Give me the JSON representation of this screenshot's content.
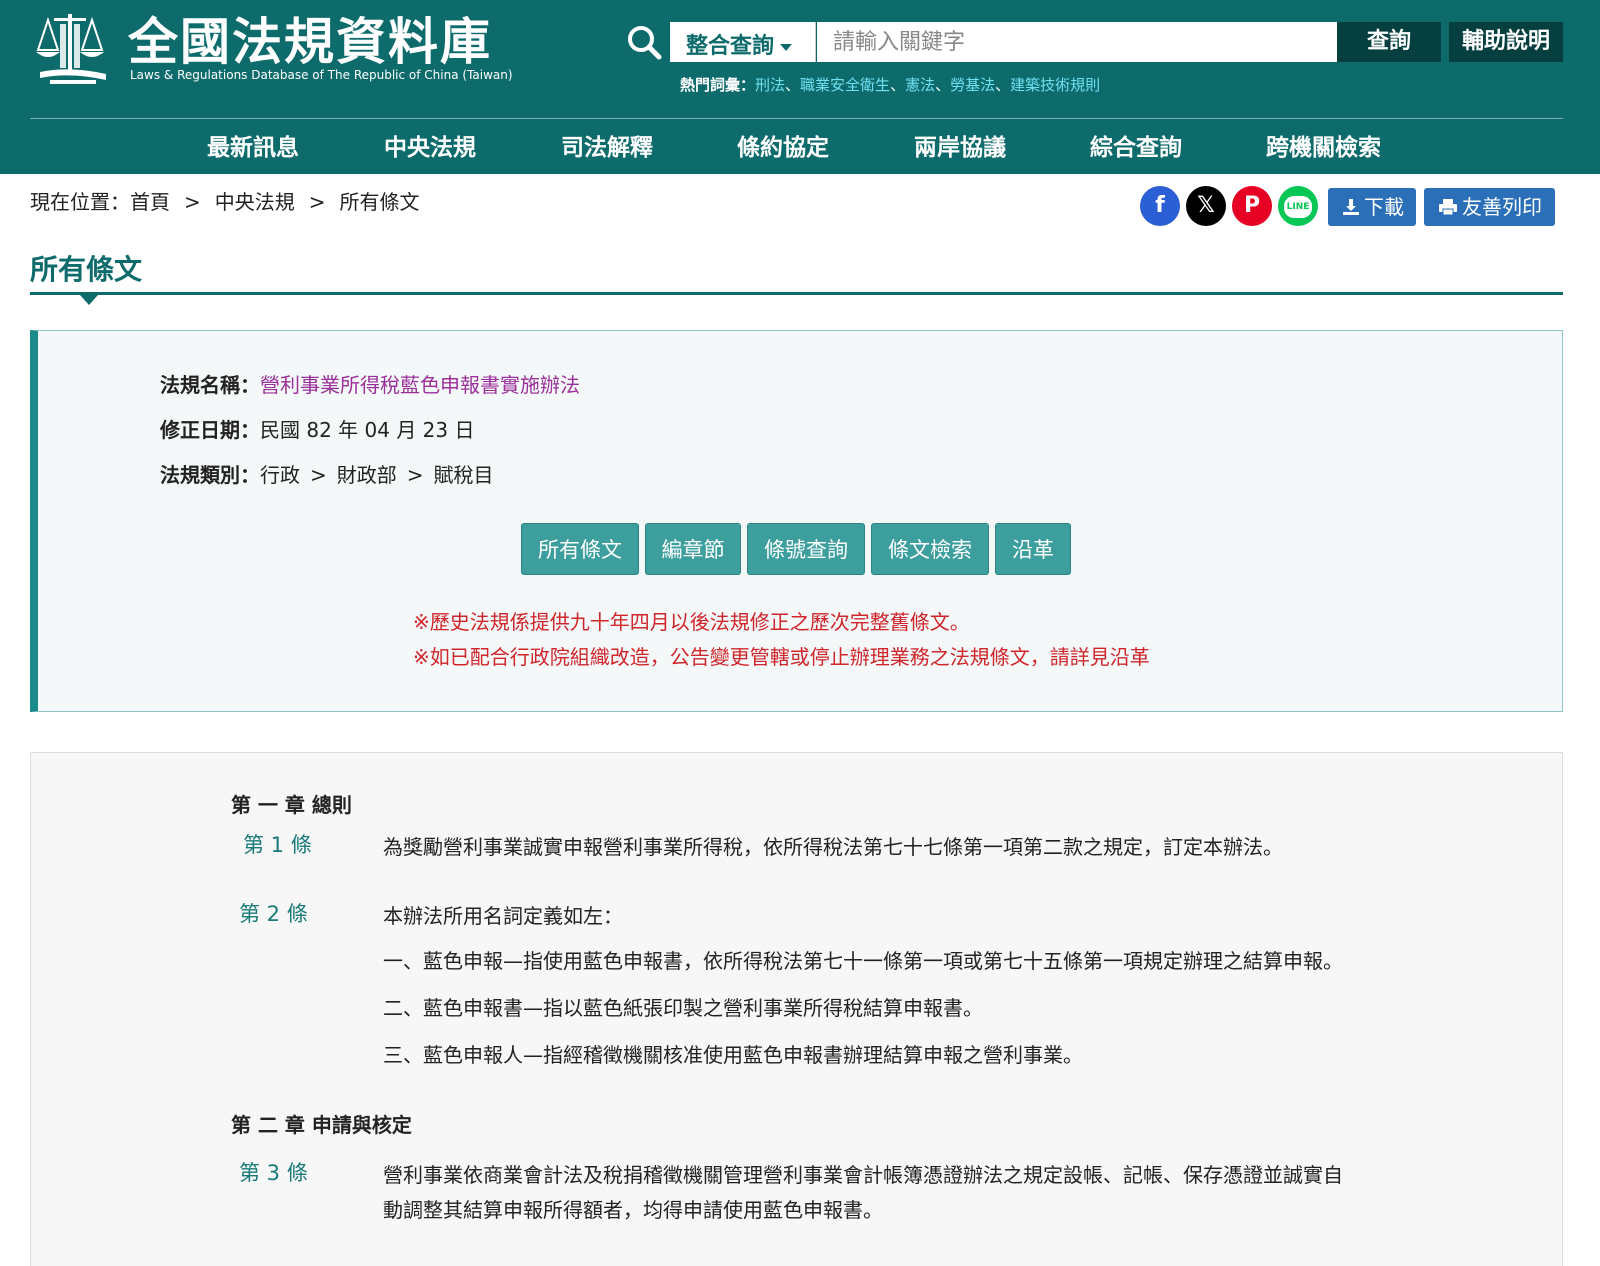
{
  "header": {
    "title": "全國法規資料庫",
    "subtitle": "Laws & Regulations Database of The Republic of China (Taiwan)",
    "search": {
      "scope": "整合查詢",
      "placeholder": "請輸入關鍵字",
      "query_label": "查詢",
      "help_label": "輔助說明"
    },
    "hot": {
      "label": "熱門詞彙：",
      "terms": [
        "刑法",
        "職業安全衛生",
        "憲法",
        "勞基法",
        "建築技術規則"
      ],
      "sep": "、"
    }
  },
  "nav": [
    "最新訊息",
    "中央法規",
    "司法解釋",
    "條約協定",
    "兩岸協議",
    "綜合查詢",
    "跨機關檢索"
  ],
  "breadcrumb": {
    "label": "現在位置：",
    "items": [
      "首頁",
      "中央法規",
      "所有條文"
    ],
    "sep": ">"
  },
  "share": {
    "facebook": "f",
    "x": "𝕏",
    "pinterest": "P",
    "line": "LINE"
  },
  "tools": {
    "download": "下載",
    "print": "友善列印"
  },
  "page_title": "所有條文",
  "info": {
    "name_label": "法規名稱：",
    "name": "營利事業所得稅藍色申報書實施辦法",
    "date_label": "修正日期：",
    "date": "民國 82 年 04 月 23 日",
    "category_label": "法規類別：",
    "category": [
      "行政",
      "財政部",
      "賦稅目"
    ],
    "tabs": [
      "所有條文",
      "編章節",
      "條號查詢",
      "條文檢索",
      "沿革"
    ],
    "notes": [
      "※歷史法規係提供九十年四月以後法規修正之歷次完整舊條文。",
      "※如已配合行政院組織改造，公告變更管轄或停止辦理業務之法規條文，請詳見沿革"
    ]
  },
  "content": {
    "chapter1": "第 一 章 總則",
    "art1_no": "第 1 條",
    "art1_text": "為獎勵營利事業誠實申報營利事業所得稅，依所得稅法第七十七條第一項第二款之規定，訂定本辦法。",
    "art2_no": "第 2 條",
    "art2_lines": [
      "本辦法所用名詞定義如左：",
      "一、藍色申報—指使用藍色申報書，依所得稅法第七十一條第一項或第七十五條第一項規定辦理之結算申報。",
      "二、藍色申報書—指以藍色紙張印製之營利事業所得稅結算申報書。",
      "三、藍色申報人—指經稽徵機關核准使用藍色申報書辦理結算申報之營利事業。"
    ],
    "chapter2": "第 二 章 申請與核定",
    "art3_no": "第 3 條",
    "art3_lines": [
      "營利事業依商業會計法及稅捐稽徵機關管理營利事業會計帳簿憑證辦法之規定設帳、記帳、保存憑證並誠實自",
      "動調整其結算申報所得額者，均得申請使用藍色申報書。"
    ]
  },
  "colors": {
    "header_bg": "#0e6b6c",
    "accent": "#1a8a8a",
    "law_name": "#9b2f9b",
    "note_red": "#d0262b",
    "hot_link": "#6fe0f2"
  }
}
